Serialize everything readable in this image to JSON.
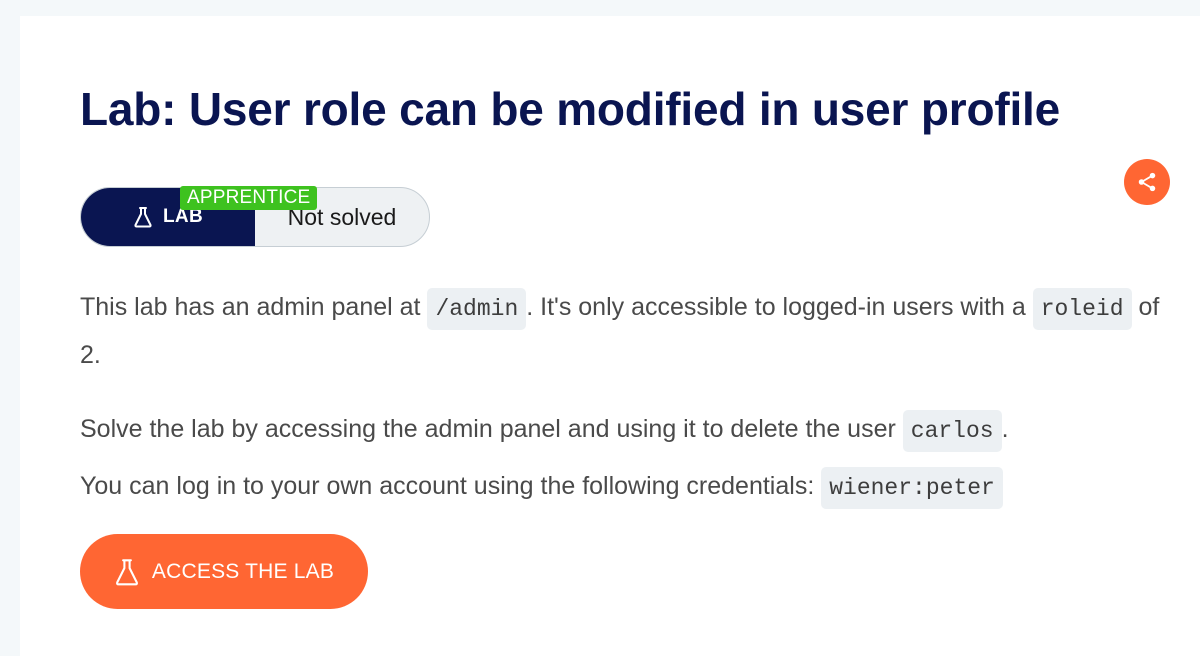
{
  "lab": {
    "title": "Lab: User role can be modified in user profile",
    "level": "APPRENTICE",
    "type_label": "LAB",
    "status": "Not solved"
  },
  "description": {
    "p1_before": "This lab has an admin panel at ",
    "p1_code1": "/admin",
    "p1_middle": ". It's only accessible to logged-in users with a ",
    "p1_code2": "roleid",
    "p1_after": " of 2.",
    "p2_before": "Solve the lab by accessing the admin panel and using it to delete the user ",
    "p2_code": "carlos",
    "p2_after": ".",
    "p3_before": "You can log in to your own account using the following credentials: ",
    "p3_code": "wiener:peter"
  },
  "actions": {
    "access_label": "ACCESS THE LAB"
  },
  "icons": {
    "share": "share-icon",
    "flask": "flask-icon"
  },
  "colors": {
    "navy": "#0a1551",
    "orange": "#ff6633",
    "green": "#3ec21f"
  }
}
